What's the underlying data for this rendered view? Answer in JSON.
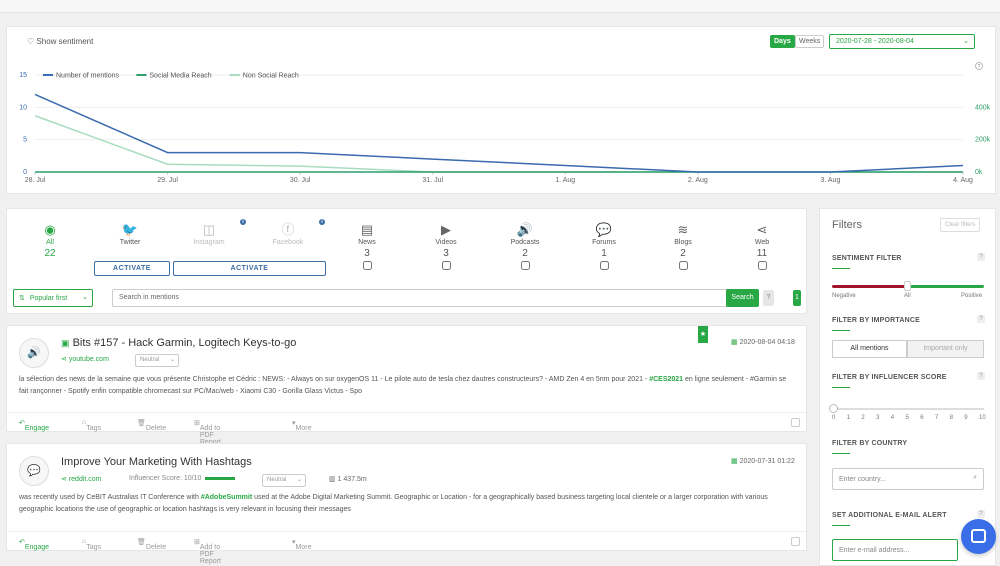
{
  "header": {
    "show_sentiment": "Show sentiment",
    "days": "Days",
    "weeks": "Weeks",
    "date_range": "2020-07-28 - 2020-08-04"
  },
  "chart_data": {
    "type": "line",
    "categories": [
      "28. Jul",
      "29. Jul",
      "30. Jul",
      "31. Jul",
      "1. Aug",
      "2. Aug",
      "3. Aug",
      "4. Aug"
    ],
    "series": [
      {
        "name": "Number of mentions",
        "values": [
          12,
          3,
          3,
          2,
          1,
          0,
          0,
          1
        ],
        "color": "#3a6ab0"
      },
      {
        "name": "Social Media Reach",
        "values": [
          0,
          0,
          0,
          0,
          0,
          0,
          0,
          0
        ],
        "color": "#2e9e6a"
      },
      {
        "name": "Non Social Reach",
        "values": [
          8.7,
          1.2,
          0.9,
          0,
          0,
          0,
          0,
          0
        ],
        "color": "#a8dcc0"
      }
    ],
    "y_left_ticks": [
      "0",
      "5",
      "10",
      "15"
    ],
    "y_right_ticks": [
      "0k",
      "200k",
      "400k"
    ],
    "ylim": [
      0,
      15
    ],
    "legend": "top-left",
    "help": "?"
  },
  "sources": {
    "items": [
      {
        "label": "All",
        "count": "22",
        "icon": "globe-icon",
        "active": true
      },
      {
        "label": "Twitter",
        "count": "",
        "icon": "twitter-icon"
      },
      {
        "label": "Instagram",
        "count": "",
        "icon": "instagram-icon"
      },
      {
        "label": "Facebook",
        "count": "",
        "icon": "facebook-icon"
      },
      {
        "label": "News",
        "count": "3",
        "icon": "news-icon"
      },
      {
        "label": "Videos",
        "count": "3",
        "icon": "play-icon"
      },
      {
        "label": "Podcasts",
        "count": "2",
        "icon": "speaker-icon"
      },
      {
        "label": "Forums",
        "count": "1",
        "icon": "forum-icon"
      },
      {
        "label": "Blogs",
        "count": "2",
        "icon": "rss-icon"
      },
      {
        "label": "Web",
        "count": "11",
        "icon": "share-icon"
      }
    ],
    "activate": "ACTIVATE",
    "info": "i"
  },
  "toolbar": {
    "sort": "Popular first",
    "search_placeholder": "Search in mentions",
    "search_button": "Search",
    "help": "?",
    "count": "1"
  },
  "mentions": [
    {
      "title": "Bits #157 - Hack Garmin, Logitech Keys-to-go",
      "source": "youtube.com",
      "sentiment": "Neutral",
      "date": "2020-08-04 04:18",
      "body_a": "la sélection des news de la semaine que vous présente Christophe et Cédric : NEWS: - Always on sur oxygenOS 11 - Le pilote auto de tesla chez dautres constructeurs? - AMD Zen 4 en 5nm pour 2021 - ",
      "hashtag": "#CES2021",
      "body_b": " en ligne seulement - #Garmin se fait rançonner - Spotify enfin compatible chromecast sur PC/Mac/web - Xiaomi C30 - Gorilla Glass Victus - Spo"
    },
    {
      "title": "Improve Your Marketing With Hashtags",
      "source": "reddit.com",
      "influencer": "Influencer Score: 10/10",
      "sentiment": "Neutral",
      "reach": "1 437.5m",
      "date": "2020-07-31 01:22",
      "body_a": "was recently used by CeBIT Australias IT Conference with ",
      "hashtag": "#AdobeSummit",
      "body_b": " used at the Adobe Digital Marketing Summit. Geographic or Location - for a geographically based business targeting local clientele or a larger corporation with various geographic locations the use of geographic or location hashtags is very relevant in focusing their messages"
    }
  ],
  "actions": {
    "engage": "Engage",
    "tags": "Tags",
    "delete": "Delete",
    "pdf": "Add to PDF Report",
    "more": "More"
  },
  "filters": {
    "title": "Filters",
    "clear": "Clear filters",
    "sentiment": {
      "title": "SENTIMENT FILTER",
      "negative": "Negative",
      "all": "All",
      "positive": "Positive"
    },
    "importance": {
      "title": "FILTER BY IMPORTANCE",
      "all": "All mentions",
      "important": "Important only"
    },
    "influencer": {
      "title": "FILTER BY INFLUENCER SCORE",
      "ticks": [
        "0",
        "1",
        "2",
        "3",
        "4",
        "5",
        "6",
        "7",
        "8",
        "9",
        "10"
      ]
    },
    "country": {
      "title": "FILTER BY COUNTRY",
      "placeholder": "Enter country..."
    },
    "email": {
      "title": "SET ADDITIONAL E-MAIL ALERT",
      "placeholder": "Enter e-mail address..."
    }
  }
}
